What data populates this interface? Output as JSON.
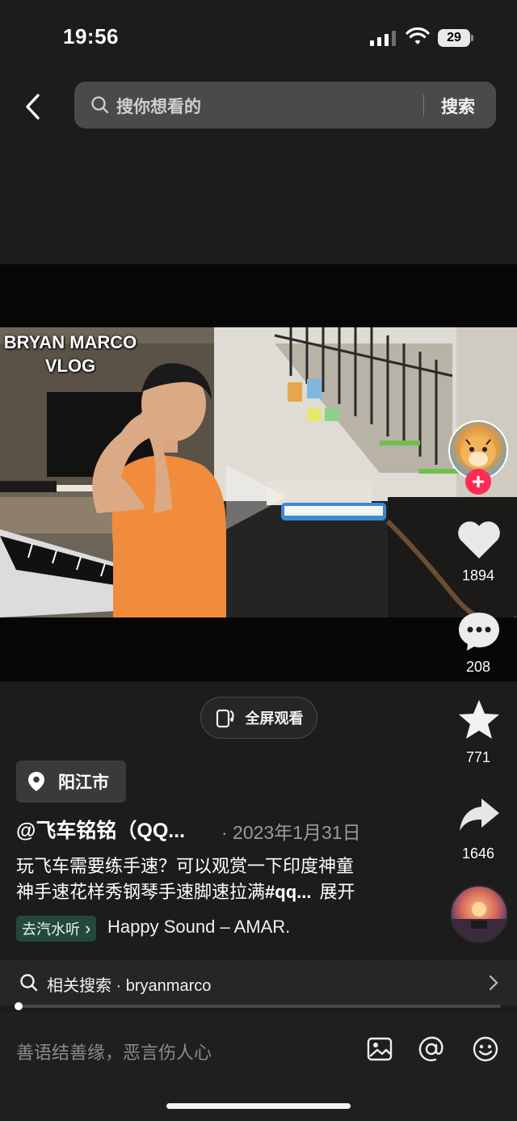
{
  "status_bar": {
    "time": "19:56",
    "battery": "29"
  },
  "header": {
    "search_placeholder": "搜你想看的",
    "search_button": "搜索"
  },
  "video": {
    "overlay_title": "BRYAN MARCO\nVLOG"
  },
  "actions": {
    "likes": "1894",
    "comments": "208",
    "favorites": "771",
    "shares": "1646",
    "follow_symbol": "+"
  },
  "fullscreen": {
    "label": "全屏观看"
  },
  "info": {
    "location": "阳江市",
    "author": "@飞车铭铭（QQ...",
    "date": "· 2023年1月31日",
    "caption_line1": "玩飞车需要练手速？可以观赏一下印度神童",
    "caption_line2": "神手速花样秀钢琴手速脚速拉满",
    "caption_tag": "#qq...",
    "expand": "展开",
    "music_link": "去汽水听",
    "music_chevron": "›",
    "song": "Happy Sound – AMAR."
  },
  "related": {
    "label": "相关搜索 · bryanmarco"
  },
  "progress": {
    "played_fraction": 0.005
  },
  "comment_bar": {
    "placeholder": "善语结善缘，恶言伤人心"
  },
  "icons": [
    "back-arrow-icon",
    "search-icon",
    "play-icon",
    "heart-icon",
    "comment-icon",
    "star-icon",
    "share-icon",
    "fullscreen-icon",
    "location-pin-icon",
    "image-icon",
    "at-icon",
    "emoji-icon",
    "chevron-right-icon"
  ]
}
